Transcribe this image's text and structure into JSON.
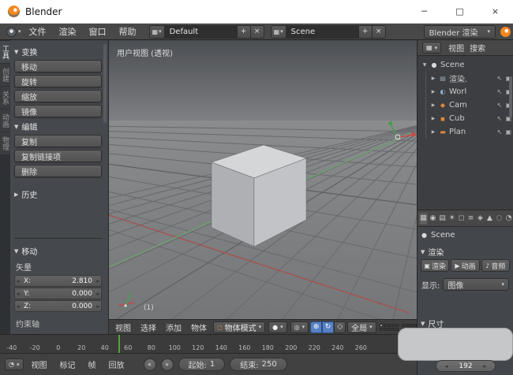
{
  "titlebar": {
    "title": "Blender",
    "minimize": "─",
    "maximize": "□",
    "close": "×"
  },
  "info_bar": {
    "menus": [
      "文件",
      "渲染",
      "窗口",
      "帮助"
    ],
    "layout_selector": {
      "value": "Default"
    },
    "scene_selector": {
      "value": "Scene"
    },
    "engine_selector": {
      "value": "Blender 渲染"
    }
  },
  "tool_tabs": [
    "工具",
    "创建",
    "关系",
    "动画",
    "物理"
  ],
  "tool_shelf": {
    "transform": {
      "title": "变换",
      "buttons": [
        "移动",
        "旋转",
        "缩放",
        "镜像"
      ]
    },
    "edit": {
      "title": "编辑",
      "buttons": [
        "复制",
        "复制链接项",
        "删除"
      ]
    },
    "history": {
      "title": "历史"
    },
    "operator": {
      "title": "移动",
      "vector_label": "矢量",
      "fields": [
        {
          "label": "X:",
          "value": "2.810"
        },
        {
          "label": "Y:",
          "value": "0.000"
        },
        {
          "label": "Z:",
          "value": "0.000"
        }
      ],
      "constraint_label": "约束轴"
    }
  },
  "viewport": {
    "view_label": "用户视图 (透视)",
    "frame_label": "(1)",
    "header": {
      "menus": [
        "视图",
        "选择",
        "添加",
        "物体"
      ],
      "mode": "物体模式",
      "orientation": "全局"
    }
  },
  "timeline": {
    "ticks": [
      "-40",
      "-20",
      "0",
      "20",
      "40",
      "60",
      "80",
      "100",
      "120",
      "140",
      "160",
      "180",
      "200",
      "220",
      "240",
      "260"
    ],
    "menus": [
      "视图",
      "标记",
      "帧",
      "回放"
    ],
    "start_label": "起始:",
    "start_value": "1",
    "end_label": "结束:",
    "end_value": "250"
  },
  "outliner": {
    "menus": [
      "视图",
      "搜索"
    ],
    "root": "Scene",
    "items": [
      "渲染.",
      "Worl",
      "Cam",
      "Cub",
      "Plan"
    ]
  },
  "properties": {
    "context_label": "Scene",
    "render_panel": {
      "title": "渲染",
      "buttons": [
        "渲染",
        "动画",
        "音频"
      ],
      "display_label": "显示:",
      "display_value": "图像"
    },
    "dimensions_panel": {
      "title": "尺寸"
    },
    "resolution_value": "192"
  },
  "icons": {
    "collapse": "▼",
    "expand": "▶",
    "caret": "▾",
    "left_arrow": "◂",
    "right_arrow": "▸",
    "plus": "+",
    "close": "×",
    "browse": "▦",
    "sphere": "●",
    "cube": "◻",
    "pivot": "◎",
    "move": "⊕",
    "rotate": "↻",
    "scale": "◇",
    "magnet": "Ω",
    "clock": "◔",
    "jump_back": "«",
    "jump_forward": "»",
    "scene": "●",
    "renderlayer": "▤",
    "world": "◐",
    "camera": "◆",
    "mesh": "◼",
    "plane": "▬",
    "pointer": "↖",
    "cam_toggle": "▣",
    "image": "▣",
    "animation": "▶",
    "audio": "♪",
    "tab_icons": [
      "▦",
      "◉",
      "▤",
      "☀",
      "◻",
      "≡",
      "◈",
      "▲",
      "◌",
      "◔"
    ]
  },
  "colors": {
    "accent_blue": "#5680c2",
    "axis_red": "#a84f4f",
    "axis_green": "#6fa16f",
    "object_orange": "#e0883c"
  }
}
